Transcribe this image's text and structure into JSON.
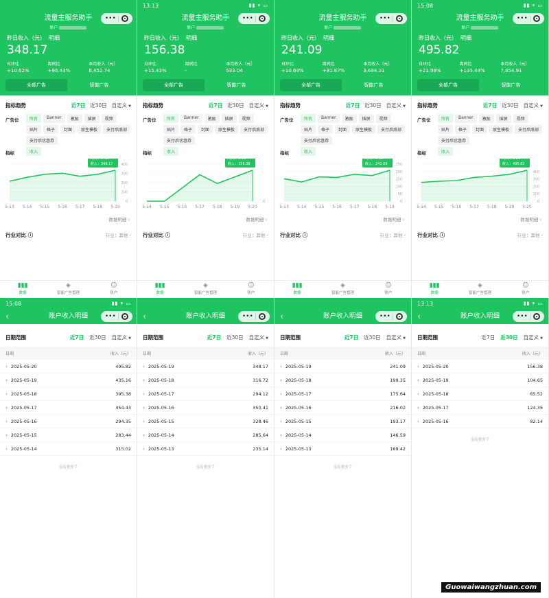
{
  "app": {
    "title": "流量主服务助手",
    "account_label": "账户",
    "detail_title": "账户收入明细"
  },
  "labels": {
    "yesterday": "昨日收入（元）",
    "detail": "明细",
    "day": "日环比",
    "week": "周同比",
    "month": "本月收入（元）",
    "all_ads": "全部广告",
    "smart_ads": "智能广告",
    "trend": "指标趋势",
    "d7": "近7日",
    "d30": "近30日",
    "custom": "自定义",
    "adpos": "广告位",
    "metric": "指标",
    "more": "数据明细",
    "industry": "行业对比",
    "industry_val": "行业：其他",
    "date_range": "日期范围",
    "col_date": "日期",
    "col_income": "收入（元）",
    "end": "没有更多了"
  },
  "nav": {
    "data": "数据",
    "smart": "智能广告管理",
    "account": "账户"
  },
  "chips": [
    "所有",
    "Banner",
    "激励",
    "插屏",
    "视频",
    "贴片",
    "格子",
    "封面",
    "原生模板",
    "支付后底部",
    "支付后优惠券"
  ],
  "metric_chip": "收入",
  "top_panels": [
    {
      "status": "",
      "value": "348.17",
      "day": "+10.62%",
      "week": "+98.43%",
      "month": "8,452.74",
      "tip_date": "时间：5-19",
      "tip_val": "收入：348.17",
      "xticks": [
        "5-13",
        "5-14",
        "5-15",
        "5-16",
        "5-17",
        "5-18",
        "5-19"
      ],
      "yticks": [
        "400",
        "300",
        "200",
        "100",
        "0"
      ],
      "chart": [
        200,
        240,
        270,
        280,
        250,
        270,
        310
      ]
    },
    {
      "status": "13:13",
      "value": "156.38",
      "day": "+15.43%",
      "week": "-",
      "month": "533.04",
      "tip_date": "时间：5-20",
      "tip_val": "收入：156.38",
      "xticks": [
        "5-14",
        "5-15",
        "5-16",
        "5-17",
        "5-18",
        "5-19",
        "5-20"
      ],
      "yticks": [
        "",
        "",
        "",
        "",
        "0"
      ],
      "chart": [
        0,
        0,
        30,
        60,
        40,
        55,
        70
      ]
    },
    {
      "status": "",
      "value": "241.09",
      "day": "+10.64%",
      "week": "+91.87%",
      "month": "3,684.31",
      "tip_date": "时间：5-19",
      "tip_val": "收入：241.09",
      "xticks": [
        "5-13",
        "5-14",
        "5-15",
        "5-16",
        "5-17",
        "5-18",
        "5-19"
      ],
      "yticks": [
        "250",
        "200",
        "150",
        "100",
        "50",
        "0"
      ],
      "chart": [
        175,
        150,
        190,
        185,
        210,
        200,
        241
      ]
    },
    {
      "status": "15:08",
      "value": "495.82",
      "day": "+21.98%",
      "week": "+135.44%",
      "month": "7,854.91",
      "tip_date": "时间：5-20",
      "tip_val": "收入：495.82",
      "xticks": [
        "5-14",
        "5-15",
        "5-16",
        "5-17",
        "5-18",
        "5-19",
        "5-20"
      ],
      "yticks": [
        "",
        "400",
        "300",
        "200",
        "100",
        "0"
      ],
      "chart": [
        300,
        320,
        330,
        380,
        400,
        430,
        495
      ]
    }
  ],
  "bottom_panels": [
    {
      "status": "15:08",
      "sel": "d7",
      "rows": [
        [
          "2025-05-20",
          "495.82"
        ],
        [
          "2025-05-19",
          "435.16"
        ],
        [
          "2025-05-18",
          "395.38"
        ],
        [
          "2025-05-17",
          "354.43"
        ],
        [
          "2025-05-16",
          "294.35"
        ],
        [
          "2025-05-15",
          "283.44"
        ],
        [
          "2025-05-14",
          "315.02"
        ]
      ]
    },
    {
      "status": "",
      "sel": "d7",
      "rows": [
        [
          "2025-05-19",
          "348.17"
        ],
        [
          "2025-05-18",
          "316.72"
        ],
        [
          "2025-05-17",
          "294.12"
        ],
        [
          "2025-05-16",
          "350.41"
        ],
        [
          "2025-05-15",
          "328.46"
        ],
        [
          "2025-05-14",
          "285.64"
        ],
        [
          "2025-05-13",
          "235.14"
        ]
      ]
    },
    {
      "status": "",
      "sel": "d7",
      "rows": [
        [
          "2025-05-19",
          "241.09"
        ],
        [
          "2025-05-18",
          "199.35"
        ],
        [
          "2025-05-17",
          "175.64"
        ],
        [
          "2025-05-16",
          "216.02"
        ],
        [
          "2025-05-15",
          "193.17"
        ],
        [
          "2025-05-14",
          "146.59"
        ],
        [
          "2025-05-13",
          "169.42"
        ]
      ]
    },
    {
      "status": "13:13",
      "sel": "d30",
      "rows": [
        [
          "2025-05-20",
          "156.38"
        ],
        [
          "2025-05-19",
          "104.65"
        ],
        [
          "2025-05-18",
          "65.52"
        ],
        [
          "2025-05-17",
          "124.35"
        ],
        [
          "2025-05-16",
          "82.14"
        ]
      ]
    }
  ],
  "watermark": "Guowaiwangzhuan.com",
  "colors": {
    "accent": "#1fc35f",
    "accent_dark": "#16a852"
  }
}
